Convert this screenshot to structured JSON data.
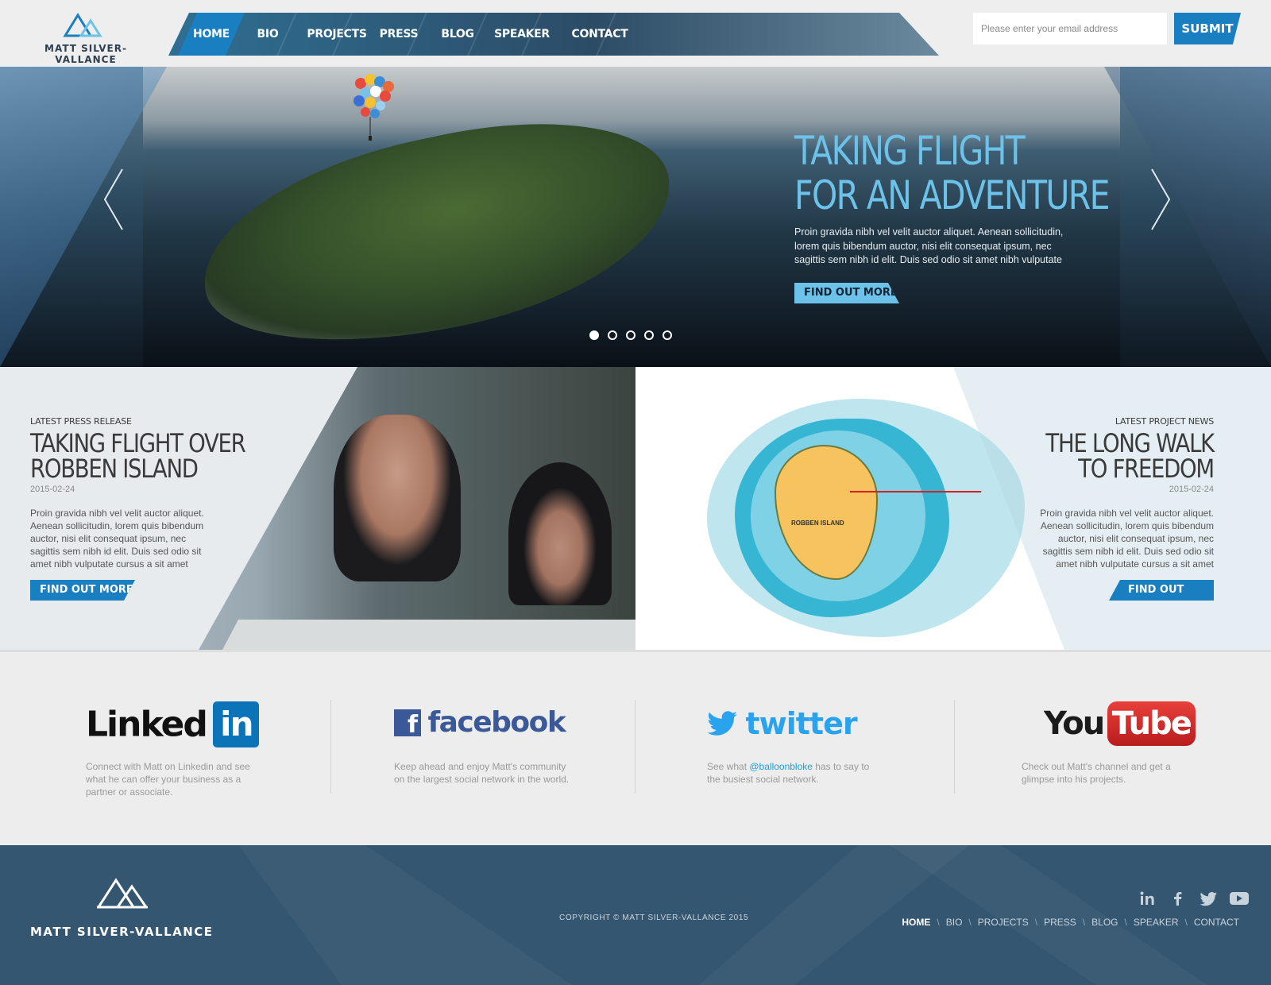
{
  "header": {
    "logo_text": "MATT SILVER-VALLANCE",
    "nav": [
      {
        "label": "HOME",
        "active": true
      },
      {
        "label": "BIO"
      },
      {
        "label": "PROJECTS"
      },
      {
        "label": "PRESS"
      },
      {
        "label": "BLOG"
      },
      {
        "label": "SPEAKER"
      },
      {
        "label": "CONTACT"
      }
    ],
    "email_placeholder": "Please enter your email address",
    "submit_label": "SUBMIT"
  },
  "hero": {
    "title_line1": "TAKING FLIGHT",
    "title_line2": "FOR AN ADVENTURE",
    "body": "Proin gravida nibh vel velit auctor aliquet. Aenean sollicitudin, lorem quis bibendum auctor, nisi elit consequat ipsum, nec sagittis sem nibh id elit. Duis sed odio sit amet nibh vulputate",
    "button_label": "FIND OUT MORE",
    "slide_count": 5,
    "active_slide": 1
  },
  "press": {
    "label": "LATEST PRESS RELEASE",
    "title_line1": "TAKING FLIGHT OVER",
    "title_line2": "ROBBEN ISLAND",
    "date": "2015-02-24",
    "body": "Proin gravida nibh vel velit auctor aliquet. Aenean sollicitudin, lorem quis bibendum auctor, nisi elit consequat ipsum, nec sagittis sem nibh id elit. Duis sed odio sit amet nibh vulputate cursus a sit amet",
    "button_label": "FIND OUT MORE"
  },
  "project": {
    "label": "LATEST PROJECT NEWS",
    "title_line1": "THE LONG WALK",
    "title_line2": "TO FREEDOM",
    "date": "2015-02-24",
    "body": "Proin gravida nibh vel velit auctor aliquet. Aenean sollicitudin, lorem quis bibendum auctor, nisi elit consequat ipsum, nec sagittis sem nibh id elit. Duis sed odio sit amet nibh vulputate cursus a sit amet",
    "button_label": "FIND OUT MORE",
    "map_label": "ROBBEN ISLAND"
  },
  "social": {
    "linkedin": {
      "logo_word": "Linked",
      "logo_box": "in",
      "desc": "Connect with Matt on Linkedin and see what he can offer your business as a partner or associate."
    },
    "facebook": {
      "logo_word": "facebook",
      "desc": "Keep ahead and enjoy Matt's community on the largest social network in the world."
    },
    "twitter": {
      "logo_word": "twitter",
      "desc_before": "See what ",
      "handle": "@balloonbloke",
      "desc_after": " has to say to the busiest social network."
    },
    "youtube": {
      "logo_you": "You",
      "logo_tube": "Tube",
      "desc": "Check out Matt's channel and get a glimpse into his projects."
    }
  },
  "footer": {
    "logo_text": "MATT SILVER-VALLANCE",
    "copyright": "COPYRIGHT © MATT SILVER-VALLANCE 2015",
    "nav": [
      {
        "label": "HOME",
        "active": true
      },
      {
        "label": "BIO"
      },
      {
        "label": "PROJECTS"
      },
      {
        "label": "PRESS"
      },
      {
        "label": "BLOG"
      },
      {
        "label": "SPEAKER"
      },
      {
        "label": "CONTACT"
      }
    ],
    "social_icons": [
      "linkedin-icon",
      "facebook-icon",
      "twitter-icon",
      "youtube-icon"
    ]
  },
  "colors": {
    "accent_blue": "#1a7fc1",
    "hero_title": "#6cc2e8",
    "footer_bg": "#355670"
  }
}
